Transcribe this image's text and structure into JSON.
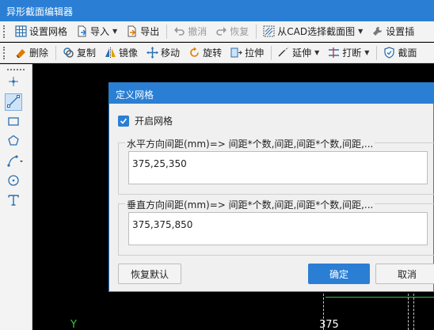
{
  "app": {
    "title": "异形截面编辑器"
  },
  "toolbar1": {
    "set_grid": "设置网格",
    "import": "导入",
    "export": "导出",
    "undo": "撤消",
    "redo": "恢复",
    "cad_select": "从CAD选择截面图",
    "set_insert": "设置插"
  },
  "toolbar2": {
    "delete": "删除",
    "copy": "复制",
    "mirror": "镜像",
    "move": "移动",
    "rotate": "旋转",
    "stretch": "拉伸",
    "extend": "延伸",
    "break": "打断",
    "section": "截面"
  },
  "left_tools": [
    "point-tool",
    "line-tool",
    "rect-tool",
    "polygon-tool",
    "polyline-tool",
    "circle-tool",
    "text-tool"
  ],
  "canvas": {
    "axis_label": "Y",
    "dimension_label": "375"
  },
  "dialog": {
    "title": "定义网格",
    "enable_grid_label": "开启网格",
    "enable_grid_checked": true,
    "horizontal_legend": "水平方向间距(mm)=> 间距*个数,间距,间距*个数,间距,...",
    "horizontal_value": "375,25,350",
    "vertical_legend": "垂直方向间距(mm)=> 间距*个数,间距,间距*个数,间距,...",
    "vertical_value": "375,375,850",
    "reset_label": "恢复默认",
    "ok_label": "确定",
    "cancel_label": "取消"
  },
  "colors": {
    "accent": "#2a7fd4",
    "grid_green": "#2ecc40"
  }
}
